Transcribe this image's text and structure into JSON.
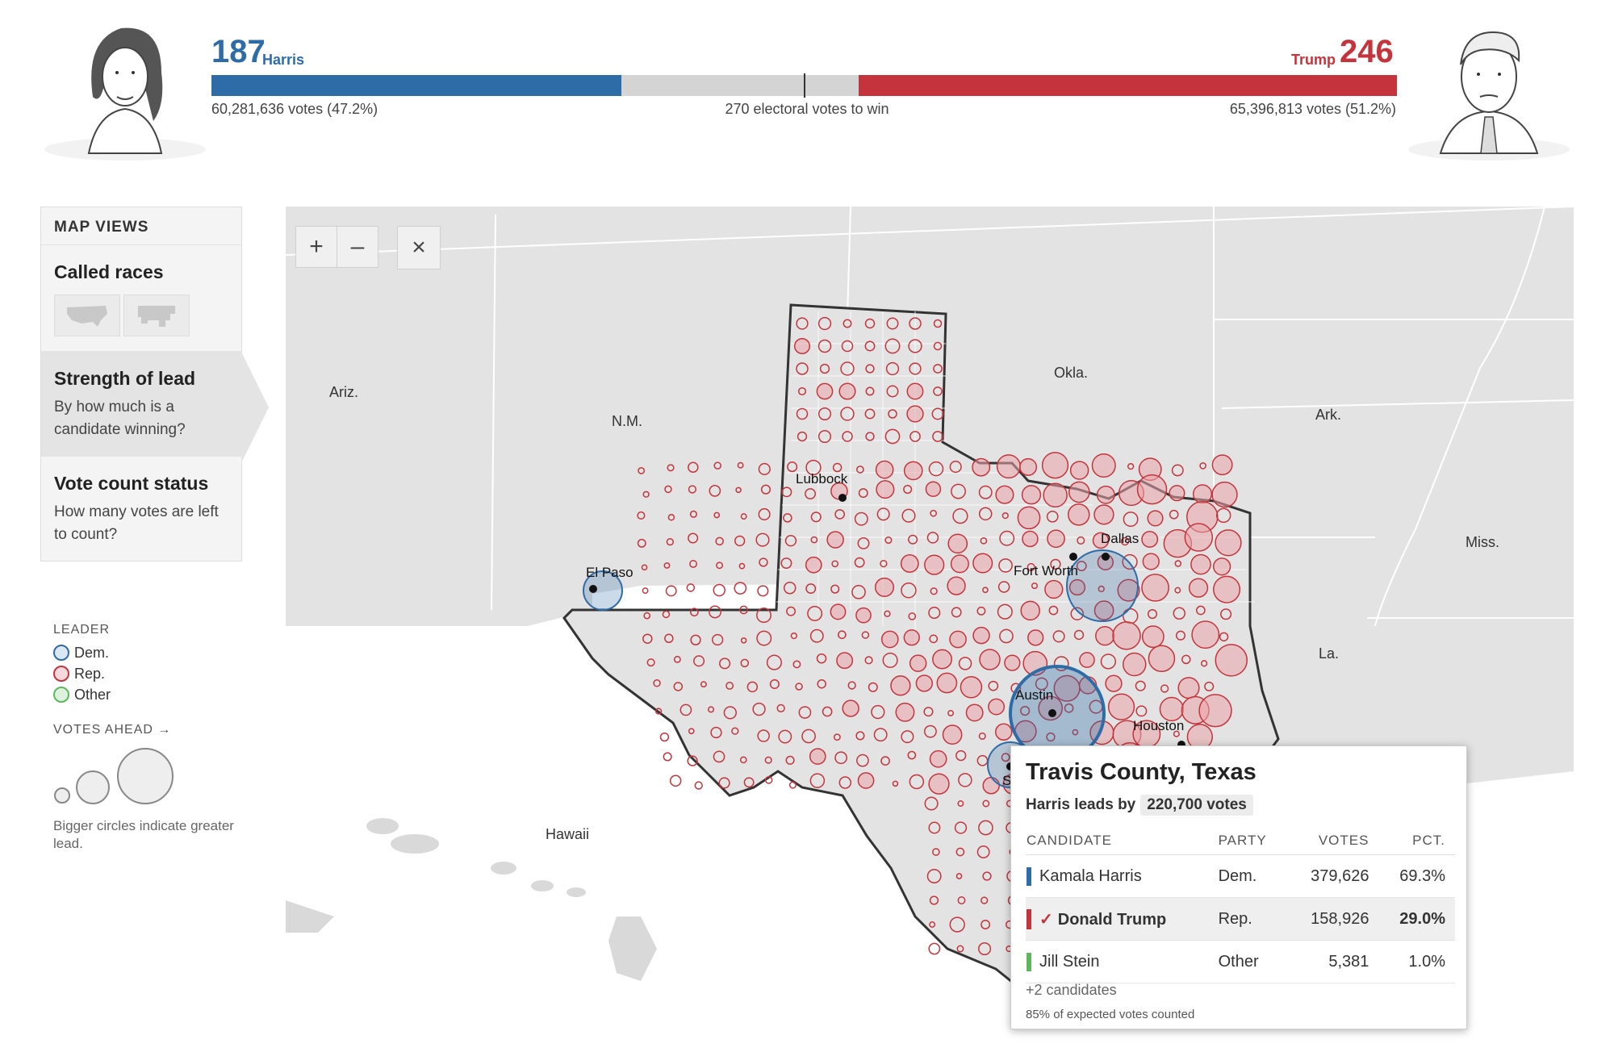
{
  "scoreboard": {
    "dem": {
      "name": "Harris",
      "electoral": "187",
      "votes": "60,281,636 votes (47.2%)",
      "color": "#2e6ca8",
      "share": 0.346
    },
    "rep": {
      "name": "Trump",
      "electoral": "246",
      "votes": "65,396,813 votes (51.2%)",
      "color": "#c5343c",
      "share": 0.454
    },
    "to_win": "270 electoral votes to win"
  },
  "panel": {
    "title": "MAP VIEWS",
    "sections": [
      {
        "heading": "Called races",
        "desc": ""
      },
      {
        "heading": "Strength of lead",
        "desc": "By how much is a candidate winning?"
      },
      {
        "heading": "Vote count status",
        "desc": "How many votes are left to count?"
      }
    ]
  },
  "legend": {
    "leader_title": "LEADER",
    "items": [
      {
        "label": "Dem.",
        "color": "#2e6ca8"
      },
      {
        "label": "Rep.",
        "color": "#c5343c"
      },
      {
        "label": "Other",
        "color": "#5cb85c"
      }
    ],
    "votes_ahead_title": "VOTES AHEAD →",
    "note": "Bigger circles indicate greater lead."
  },
  "map": {
    "state_labels": [
      "Ariz.",
      "N.M.",
      "Okla.",
      "Ark.",
      "Miss.",
      "La.",
      "Hawaii"
    ],
    "city_labels": [
      "Lubbock",
      "El Paso",
      "Dallas",
      "Fort Worth",
      "Austin",
      "Houston",
      "S"
    ],
    "controls": {
      "zoom_in": "+",
      "zoom_out": "–",
      "close": "×"
    }
  },
  "tooltip": {
    "title": "Travis County, Texas",
    "lead_text": "Harris leads by",
    "lead_value": "220,700 votes",
    "headers": [
      "CANDIDATE",
      "PARTY",
      "VOTES",
      "PCT."
    ],
    "rows": [
      {
        "name": "Kamala Harris",
        "party": "Dem.",
        "votes": "379,626",
        "pct": "69.3%",
        "color": "#2e6ca8",
        "winner": false
      },
      {
        "name": "Donald Trump",
        "party": "Rep.",
        "votes": "158,926",
        "pct": "29.0%",
        "color": "#c5343c",
        "winner": true
      },
      {
        "name": "Jill Stein",
        "party": "Other",
        "votes": "5,381",
        "pct": "1.0%",
        "color": "#5cb85c",
        "winner": false
      }
    ],
    "more": "+2 candidates",
    "footer": "85% of expected votes counted"
  }
}
